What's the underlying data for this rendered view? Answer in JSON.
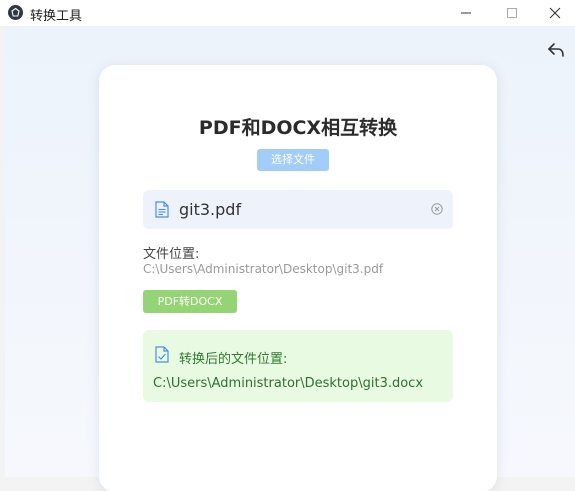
{
  "window": {
    "title": "转换工具",
    "icons": {
      "app": "app-logo-icon",
      "minimize": "minimize-icon",
      "maximize": "maximize-icon",
      "close": "close-icon",
      "back": "back-arrow-icon"
    }
  },
  "card": {
    "title": "PDF和DOCX相互转换",
    "select_button": "选择文件",
    "file": {
      "name": "git3.pdf",
      "icon": "document-icon",
      "remove_icon": "clear-circle-icon"
    },
    "location_label": "文件位置:",
    "location_path": "C:\\Users\\Administrator\\Desktop\\git3.pdf",
    "convert_button": "PDF转DOCX",
    "result": {
      "icon": "document-check-icon",
      "label": "转换后的文件位置:",
      "path": "C:\\Users\\Administrator\\Desktop\\git3.docx"
    }
  },
  "colors": {
    "select_button": "#a1cdf8",
    "convert_button": "#95d475",
    "result_background": "#e8fbe2",
    "result_text": "#2f7a2f",
    "file_row_background": "#eef3fb",
    "accent_blue": "#4a90e2"
  }
}
